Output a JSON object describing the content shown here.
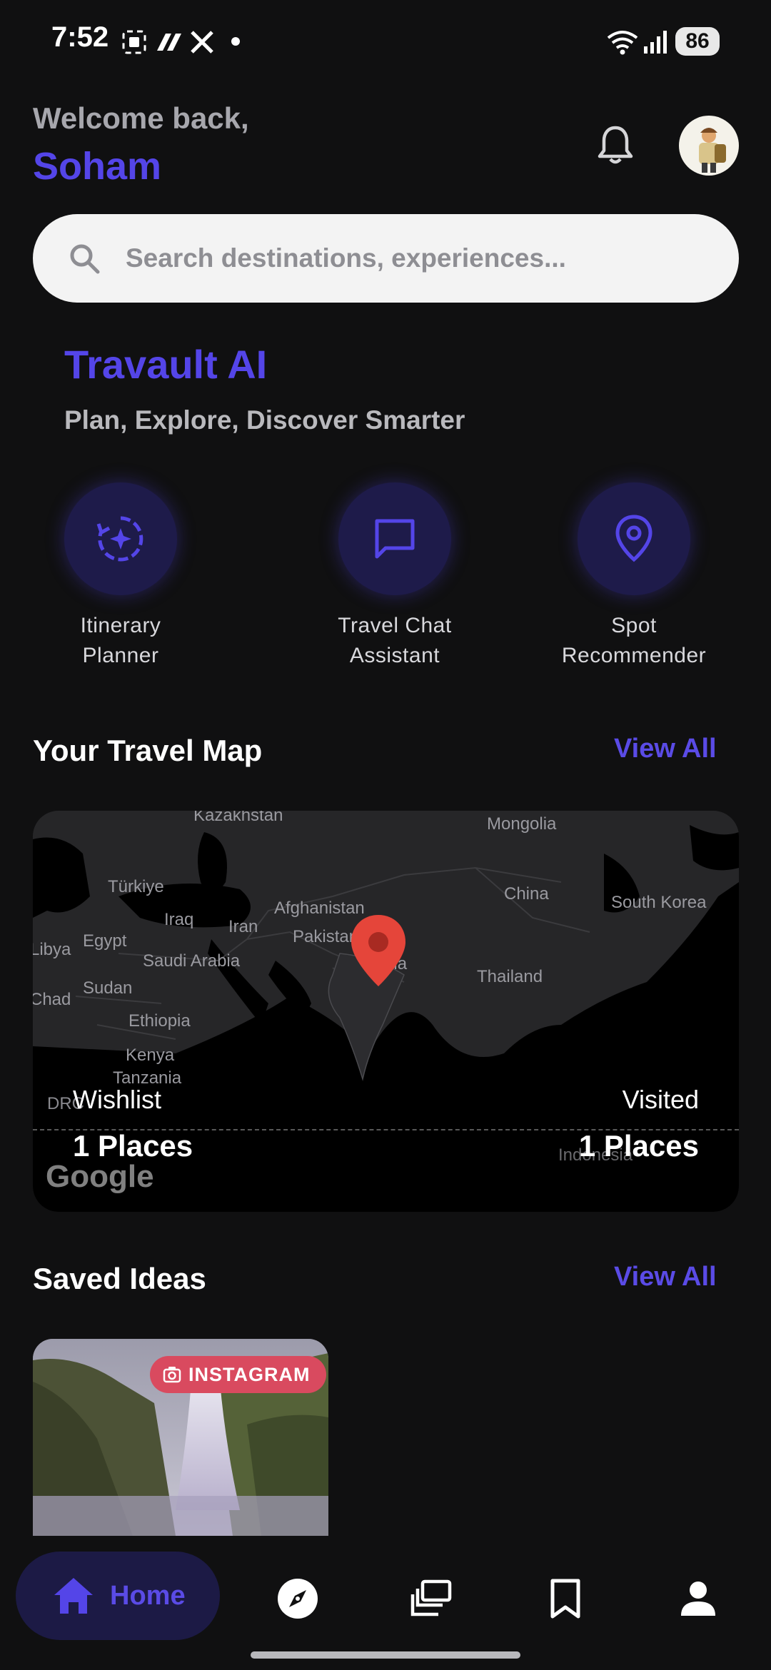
{
  "status_bar": {
    "time": "7:52",
    "battery": "86"
  },
  "header": {
    "welcome": "Welcome back,",
    "username": "Soham"
  },
  "search": {
    "placeholder": "Search destinations, experiences..."
  },
  "hero": {
    "title": "Travault AI",
    "subtitle": "Plan, Explore, Discover Smarter"
  },
  "features": [
    {
      "label": "Itinerary\nPlanner",
      "icon": "itinerary-icon"
    },
    {
      "label": "Travel Chat\nAssistant",
      "icon": "chat-icon"
    },
    {
      "label": "Spot\nRecommender",
      "icon": "location-pin-icon"
    }
  ],
  "travel_map": {
    "title": "Your Travel Map",
    "view_all": "View All",
    "wishlist_label": "Wishlist",
    "wishlist_value": "1 Places",
    "visited_label": "Visited",
    "visited_value": "1 Places",
    "map_labels": [
      "Kazakhstan",
      "Mongolia",
      "Türkiye",
      "China",
      "South Korea",
      "Iraq",
      "Iran",
      "Afghanistan",
      "Pakistan",
      "India",
      "Egypt",
      "Saudi Arabia",
      "Thailand",
      "Sudan",
      "Ethiopia",
      "Kenya",
      "Tanzania",
      "Indonesia",
      "Chad",
      "Libya",
      "DRC"
    ],
    "attribution": "Google"
  },
  "saved_ideas": {
    "title": "Saved Ideas",
    "view_all": "View All",
    "cards": [
      {
        "source": "INSTAGRAM"
      }
    ]
  },
  "bottom_nav": {
    "home_label": "Home"
  },
  "colors": {
    "accent": "#5445e8",
    "background": "#101011",
    "badge": "#d94a5f"
  }
}
